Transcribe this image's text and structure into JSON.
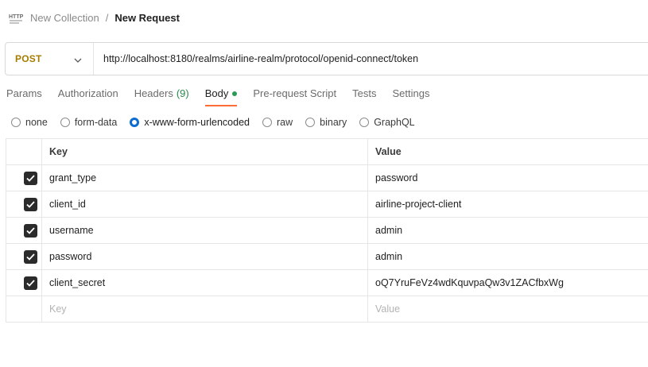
{
  "breadcrumb": {
    "icon": "http-file-icon",
    "parent": "New Collection",
    "separator": "/",
    "current": "New Request"
  },
  "request": {
    "method": "POST",
    "method_color": "#a57c00",
    "url": "http://localhost:8180/realms/airline-realm/protocol/openid-connect/token"
  },
  "tabs": [
    {
      "label": "Params"
    },
    {
      "label": "Authorization"
    },
    {
      "label": "Headers",
      "count": "(9)"
    },
    {
      "label": "Body",
      "active": true,
      "indicator": "green-dot"
    },
    {
      "label": "Pre-request Script"
    },
    {
      "label": "Tests"
    },
    {
      "label": "Settings"
    }
  ],
  "body_types": [
    {
      "label": "none"
    },
    {
      "label": "form-data"
    },
    {
      "label": "x-www-form-urlencoded",
      "selected": true
    },
    {
      "label": "raw"
    },
    {
      "label": "binary"
    },
    {
      "label": "GraphQL"
    }
  ],
  "table": {
    "headers": {
      "key": "Key",
      "value": "Value"
    },
    "rows": [
      {
        "checked": true,
        "key": "grant_type",
        "value": "password"
      },
      {
        "checked": true,
        "key": "client_id",
        "value": "airline-project-client"
      },
      {
        "checked": true,
        "key": "username",
        "value": "admin"
      },
      {
        "checked": true,
        "key": "password",
        "value": "admin"
      },
      {
        "checked": true,
        "key": "client_secret",
        "value": "oQ7YruFeVz4wdKquvpaQw3v1ZACfbxWg"
      }
    ],
    "placeholder": {
      "key": "Key",
      "value": "Value"
    }
  },
  "colors": {
    "accent": "#ff6c37",
    "radio_selected": "#0d6bd1",
    "body_dot": "#2a9a54",
    "checkbox": "#2b2b2b"
  }
}
